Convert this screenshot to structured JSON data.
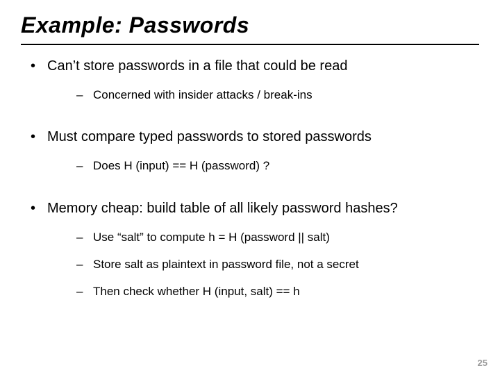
{
  "title": "Example:  Passwords",
  "bullets": [
    {
      "text": "Can’t store passwords in a file that could be read",
      "sub": [
        "Concerned with insider attacks / break-ins"
      ]
    },
    {
      "text": "Must compare typed passwords to stored passwords",
      "sub": [
        "Does H (input) == H (password) ?"
      ]
    },
    {
      "text": "Memory cheap: build table of all likely password hashes?",
      "sub": [
        "Use “salt” to compute h = H (password || salt)",
        "Store salt as plaintext in password file, not a secret",
        "Then check whether  H (input, salt) == h"
      ]
    }
  ],
  "page_number": "25"
}
